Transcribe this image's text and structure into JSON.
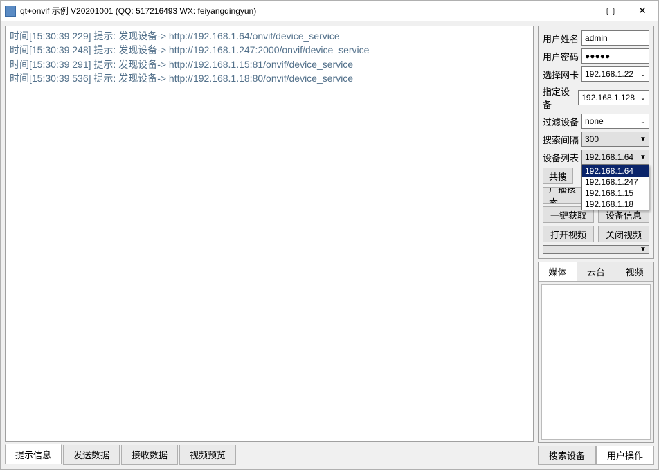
{
  "window": {
    "title": "qt+onvif 示例 V20201001 (QQ: 517216493 WX: feiyangqingyun)"
  },
  "log": [
    "时间[15:30:39 229] 提示: 发现设备-> http://192.168.1.64/onvif/device_service",
    "时间[15:30:39 248] 提示: 发现设备-> http://192.168.1.247:2000/onvif/device_service",
    "时间[15:30:39 291] 提示: 发现设备-> http://192.168.1.15:81/onvif/device_service",
    "时间[15:30:39 536] 提示: 发现设备-> http://192.168.1.18:80/onvif/device_service"
  ],
  "left_tabs": [
    "提示信息",
    "发送数据",
    "接收数据",
    "视频预览"
  ],
  "left_tabs_active": 0,
  "form": {
    "username_label": "用户姓名",
    "username_value": "admin",
    "password_label": "用户密码",
    "password_value": "●●●●●",
    "nic_label": "选择网卡",
    "nic_value": "192.168.1.22",
    "target_label": "指定设备",
    "target_value": "192.168.1.128",
    "filter_label": "过滤设备",
    "filter_value": "none",
    "interval_label": "搜索间隔",
    "interval_value": "300",
    "devlist_label": "设备列表",
    "devlist_value": "192.168.1.64",
    "devlist_options": [
      "192.168.1.64",
      "192.168.1.247",
      "192.168.1.15",
      "192.168.1.18"
    ]
  },
  "buttons": {
    "share_search": "共搜",
    "broadcast_search": "广播搜索",
    "one_click": "一键获取",
    "device_info": "设备信息",
    "open_video": "打开视频",
    "close_video": "关闭视频"
  },
  "panel2_tabs": [
    "媒体",
    "云台",
    "视频"
  ],
  "panel2_active": 0,
  "right_bottom_tabs": [
    "搜索设备",
    "用户操作"
  ],
  "right_bottom_active": 1
}
